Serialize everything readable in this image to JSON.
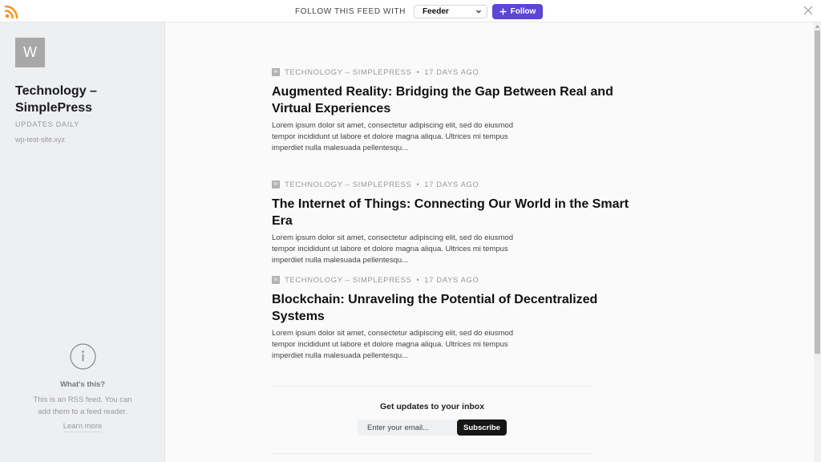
{
  "topbar": {
    "logo_icon": "rss-icon",
    "follow_label": "FOLLOW THIS FEED WITH",
    "reader_selected": "Feeder",
    "follow_button": "Follow",
    "brand_color": "#5b46d6",
    "rss_color": "#f7931e"
  },
  "sidebar": {
    "avatar_letter": "W",
    "feed_title": "Technology – SimplePress",
    "update_frequency": "UPDATES DAILY",
    "site_url": "wp-test-site.xyz",
    "info": {
      "icon": "info-icon",
      "heading": "What's this?",
      "text": "This is an RSS feed. You can add them to a feed reader.",
      "link": "Learn more"
    }
  },
  "articles": [
    {
      "source": "TECHNOLOGY – SIMPLEPRESS",
      "age": "17 DAYS AGO",
      "title": "Augmented Reality: Bridging the Gap Between Real and Virtual Experiences",
      "excerpt": "Lorem ipsum dolor sit amet, consectetur adipiscing elit, sed do eiusmod tempor incididunt ut labore et dolore magna aliqua. Ultrices mi tempus imperdiet nulla malesuada pellentesqu..."
    },
    {
      "source": "TECHNOLOGY – SIMPLEPRESS",
      "age": "17 DAYS AGO",
      "title": "The Internet of Things: Connecting Our World in the Smart Era",
      "excerpt": "Lorem ipsum dolor sit amet, consectetur adipiscing elit, sed do eiusmod tempor incididunt ut labore et dolore magna aliqua. Ultrices mi tempus imperdiet nulla malesuada pellentesqu..."
    },
    {
      "source": "TECHNOLOGY – SIMPLEPRESS",
      "age": "17 DAYS AGO",
      "title": "Blockchain: Unraveling the Potential of Decentralized Systems",
      "excerpt": "Lorem ipsum dolor sit amet, consectetur adipiscing elit, sed do eiusmod tempor incididunt ut labore et dolore magna aliqua. Ultrices mi tempus imperdiet nulla malesuada pellentesqu..."
    }
  ],
  "meta_icon_letter": "W",
  "meta_separator": "•",
  "subscribe": {
    "heading": "Get updates to your inbox",
    "placeholder": "Enter your email...",
    "button": "Subscribe"
  }
}
